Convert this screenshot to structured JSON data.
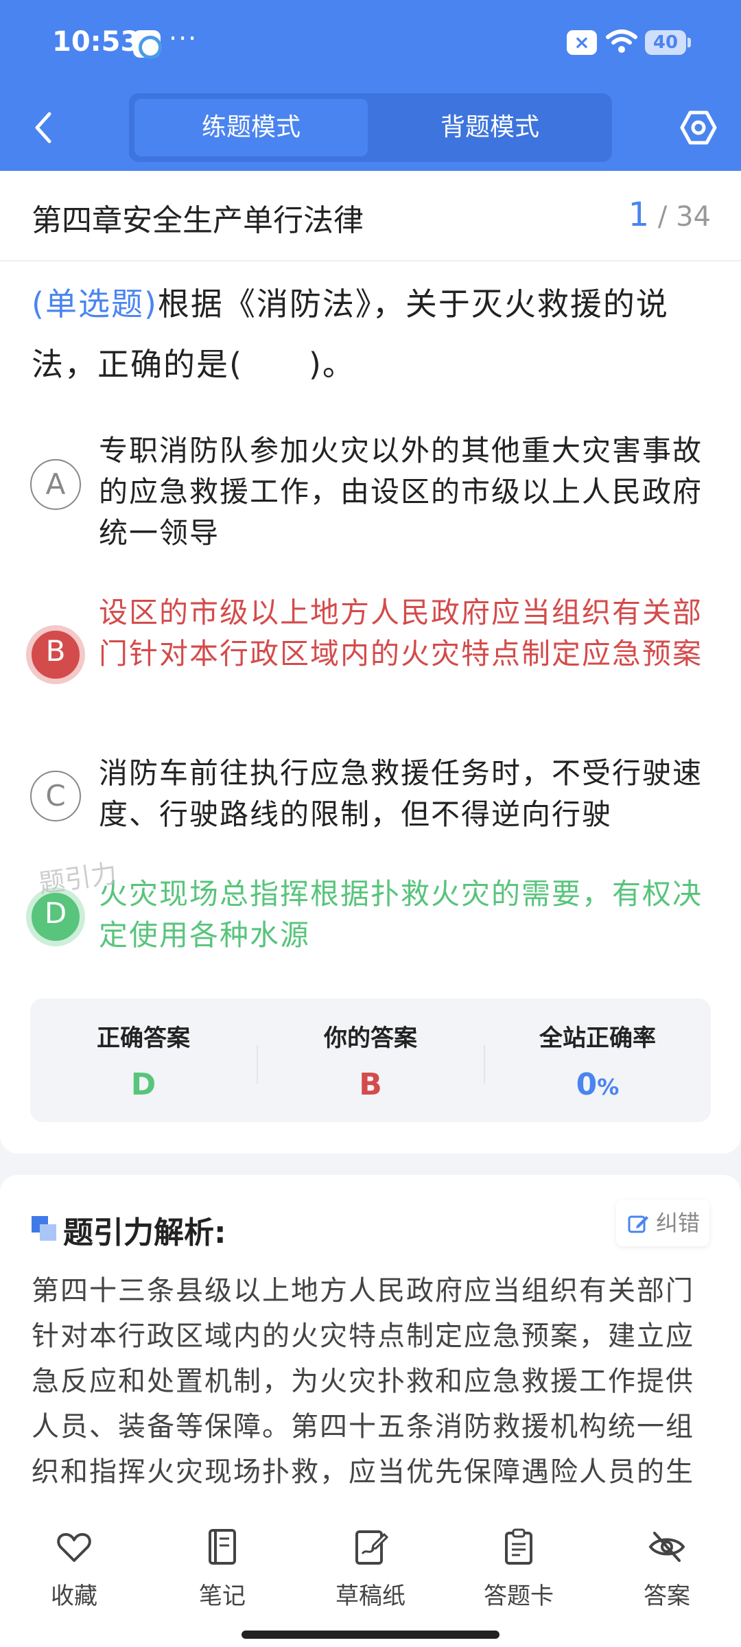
{
  "status_bar": {
    "time": "10:53",
    "dots": "···",
    "battery": "40"
  },
  "header": {
    "modes": [
      {
        "label": "练题模式",
        "active": true
      },
      {
        "label": "背题模式",
        "active": false
      }
    ]
  },
  "question_card": {
    "chapter": "第四章安全生产单行法律",
    "progress": {
      "current": "1",
      "total": "/ 34"
    },
    "type_label": "(单选题)",
    "stem": "根据《消防法》，关于灭火救援的说法，正确的是(　　)。",
    "options": [
      {
        "letter": "A",
        "text": "专职消防队参加火灾以外的其他重大灾害事故的应急救援工作，由设区的市级以上人民政府统一领导",
        "state": "normal"
      },
      {
        "letter": "B",
        "text": "设区的市级以上地方人民政府应当组织有关部门针对本行政区域内的火灾特点制定应急预案",
        "state": "wrong"
      },
      {
        "letter": "C",
        "text": "消防车前往执行应急救援任务时，不受行驶速度、行驶路线的限制，但不得逆向行驶",
        "state": "normal"
      },
      {
        "letter": "D",
        "text": "火灾现场总指挥根据扑救火灾的需要，有权决定使用各种水源",
        "state": "correct"
      }
    ],
    "watermark": "题引力",
    "stats": {
      "correct_label": "正确答案",
      "correct_value": "D",
      "yours_label": "你的答案",
      "yours_value": "B",
      "rate_label": "全站正确率",
      "rate_value": "0",
      "rate_unit": "%"
    }
  },
  "analysis": {
    "title": "题引力解析:",
    "fix_label": "纠错",
    "text": "第四十三条县级以上地方人民政府应当组织有关部门针对本行政区域内的火灾特点制定应急预案，建立应急反应和处置机制，为火灾扑救和应急救援工作提供人员、装备等保障。第四十五条消防救援机构统一组织和指挥火灾现场扑救，应当优先保障遇险人员的生"
  },
  "bottom_nav": [
    {
      "label": "收藏",
      "icon": "heart-icon"
    },
    {
      "label": "笔记",
      "icon": "notebook-icon"
    },
    {
      "label": "草稿纸",
      "icon": "draft-paper-icon"
    },
    {
      "label": "答题卡",
      "icon": "answer-sheet-icon"
    },
    {
      "label": "答案",
      "icon": "eye-off-icon"
    }
  ],
  "colors": {
    "primary": "#4a84f0",
    "wrong": "#d44b4b",
    "correct": "#58c47c"
  }
}
